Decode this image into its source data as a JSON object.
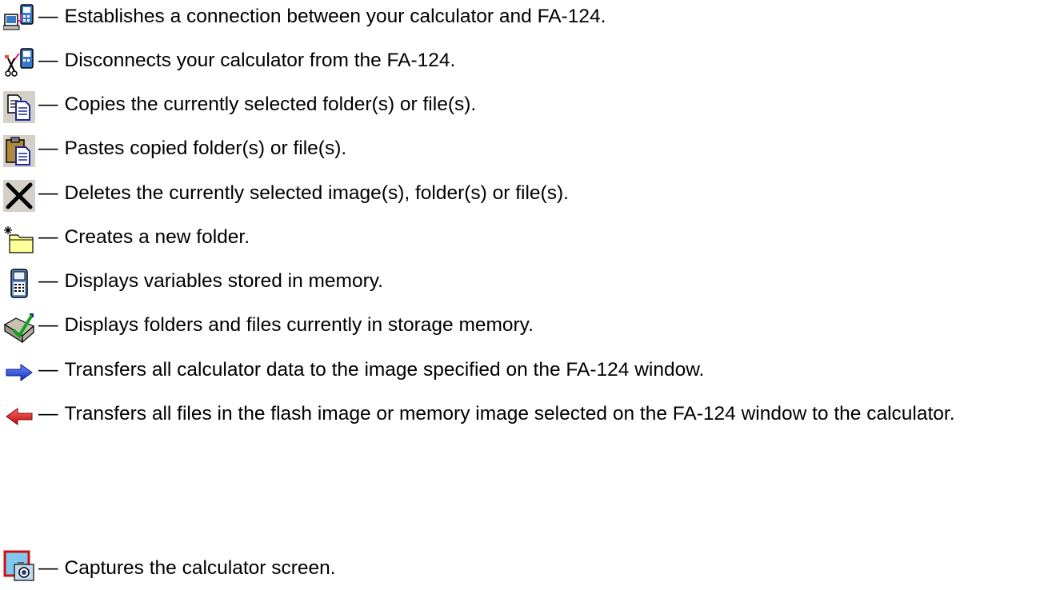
{
  "dash": "—",
  "items": [
    {
      "icon": "connect-icon",
      "text": "Establishes a connection between your calculator and FA-124."
    },
    {
      "icon": "disconnect-icon",
      "text": "Disconnects your calculator from the FA-124."
    },
    {
      "icon": "copy-icon",
      "text": "Copies the currently selected folder(s) or file(s)."
    },
    {
      "icon": "paste-icon",
      "text": "Pastes copied folder(s) or file(s)."
    },
    {
      "icon": "delete-icon",
      "text": "Deletes the currently selected image(s), folder(s) or file(s)."
    },
    {
      "icon": "new-folder-icon",
      "text": "Creates a new folder."
    },
    {
      "icon": "calculator-memory-icon",
      "text": "Displays variables stored in memory."
    },
    {
      "icon": "storage-memory-icon",
      "text": "Displays folders and files currently in storage memory."
    },
    {
      "icon": "send-to-image-icon",
      "text": "Transfers all calculator data to the image specified on the FA-124 window."
    },
    {
      "icon": "send-to-calculator-icon",
      "text": "Transfers all files in the flash image or memory image selected on the FA-124 window to the calculator."
    },
    {
      "icon": "screen-capture-icon",
      "text": "Captures the calculator screen."
    }
  ],
  "colors": {
    "text": "#000000",
    "arrow_right": "#1f3fd6",
    "arrow_left": "#d41414",
    "folder_yellow": "#ffff99",
    "toolbar_gray": "#d4d0c8"
  }
}
